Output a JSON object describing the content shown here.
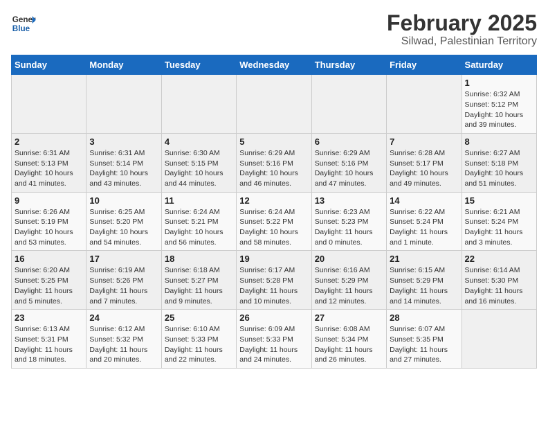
{
  "header": {
    "logo_line1": "General",
    "logo_line2": "Blue",
    "title": "February 2025",
    "subtitle": "Silwad, Palestinian Territory"
  },
  "weekdays": [
    "Sunday",
    "Monday",
    "Tuesday",
    "Wednesday",
    "Thursday",
    "Friday",
    "Saturday"
  ],
  "weeks": [
    [
      {
        "day": "",
        "info": ""
      },
      {
        "day": "",
        "info": ""
      },
      {
        "day": "",
        "info": ""
      },
      {
        "day": "",
        "info": ""
      },
      {
        "day": "",
        "info": ""
      },
      {
        "day": "",
        "info": ""
      },
      {
        "day": "1",
        "info": "Sunrise: 6:32 AM\nSunset: 5:12 PM\nDaylight: 10 hours and 39 minutes."
      }
    ],
    [
      {
        "day": "2",
        "info": "Sunrise: 6:31 AM\nSunset: 5:13 PM\nDaylight: 10 hours and 41 minutes."
      },
      {
        "day": "3",
        "info": "Sunrise: 6:31 AM\nSunset: 5:14 PM\nDaylight: 10 hours and 43 minutes."
      },
      {
        "day": "4",
        "info": "Sunrise: 6:30 AM\nSunset: 5:15 PM\nDaylight: 10 hours and 44 minutes."
      },
      {
        "day": "5",
        "info": "Sunrise: 6:29 AM\nSunset: 5:16 PM\nDaylight: 10 hours and 46 minutes."
      },
      {
        "day": "6",
        "info": "Sunrise: 6:29 AM\nSunset: 5:16 PM\nDaylight: 10 hours and 47 minutes."
      },
      {
        "day": "7",
        "info": "Sunrise: 6:28 AM\nSunset: 5:17 PM\nDaylight: 10 hours and 49 minutes."
      },
      {
        "day": "8",
        "info": "Sunrise: 6:27 AM\nSunset: 5:18 PM\nDaylight: 10 hours and 51 minutes."
      }
    ],
    [
      {
        "day": "9",
        "info": "Sunrise: 6:26 AM\nSunset: 5:19 PM\nDaylight: 10 hours and 53 minutes."
      },
      {
        "day": "10",
        "info": "Sunrise: 6:25 AM\nSunset: 5:20 PM\nDaylight: 10 hours and 54 minutes."
      },
      {
        "day": "11",
        "info": "Sunrise: 6:24 AM\nSunset: 5:21 PM\nDaylight: 10 hours and 56 minutes."
      },
      {
        "day": "12",
        "info": "Sunrise: 6:24 AM\nSunset: 5:22 PM\nDaylight: 10 hours and 58 minutes."
      },
      {
        "day": "13",
        "info": "Sunrise: 6:23 AM\nSunset: 5:23 PM\nDaylight: 11 hours and 0 minutes."
      },
      {
        "day": "14",
        "info": "Sunrise: 6:22 AM\nSunset: 5:24 PM\nDaylight: 11 hours and 1 minute."
      },
      {
        "day": "15",
        "info": "Sunrise: 6:21 AM\nSunset: 5:24 PM\nDaylight: 11 hours and 3 minutes."
      }
    ],
    [
      {
        "day": "16",
        "info": "Sunrise: 6:20 AM\nSunset: 5:25 PM\nDaylight: 11 hours and 5 minutes."
      },
      {
        "day": "17",
        "info": "Sunrise: 6:19 AM\nSunset: 5:26 PM\nDaylight: 11 hours and 7 minutes."
      },
      {
        "day": "18",
        "info": "Sunrise: 6:18 AM\nSunset: 5:27 PM\nDaylight: 11 hours and 9 minutes."
      },
      {
        "day": "19",
        "info": "Sunrise: 6:17 AM\nSunset: 5:28 PM\nDaylight: 11 hours and 10 minutes."
      },
      {
        "day": "20",
        "info": "Sunrise: 6:16 AM\nSunset: 5:29 PM\nDaylight: 11 hours and 12 minutes."
      },
      {
        "day": "21",
        "info": "Sunrise: 6:15 AM\nSunset: 5:29 PM\nDaylight: 11 hours and 14 minutes."
      },
      {
        "day": "22",
        "info": "Sunrise: 6:14 AM\nSunset: 5:30 PM\nDaylight: 11 hours and 16 minutes."
      }
    ],
    [
      {
        "day": "23",
        "info": "Sunrise: 6:13 AM\nSunset: 5:31 PM\nDaylight: 11 hours and 18 minutes."
      },
      {
        "day": "24",
        "info": "Sunrise: 6:12 AM\nSunset: 5:32 PM\nDaylight: 11 hours and 20 minutes."
      },
      {
        "day": "25",
        "info": "Sunrise: 6:10 AM\nSunset: 5:33 PM\nDaylight: 11 hours and 22 minutes."
      },
      {
        "day": "26",
        "info": "Sunrise: 6:09 AM\nSunset: 5:33 PM\nDaylight: 11 hours and 24 minutes."
      },
      {
        "day": "27",
        "info": "Sunrise: 6:08 AM\nSunset: 5:34 PM\nDaylight: 11 hours and 26 minutes."
      },
      {
        "day": "28",
        "info": "Sunrise: 6:07 AM\nSunset: 5:35 PM\nDaylight: 11 hours and 27 minutes."
      },
      {
        "day": "",
        "info": ""
      }
    ]
  ]
}
